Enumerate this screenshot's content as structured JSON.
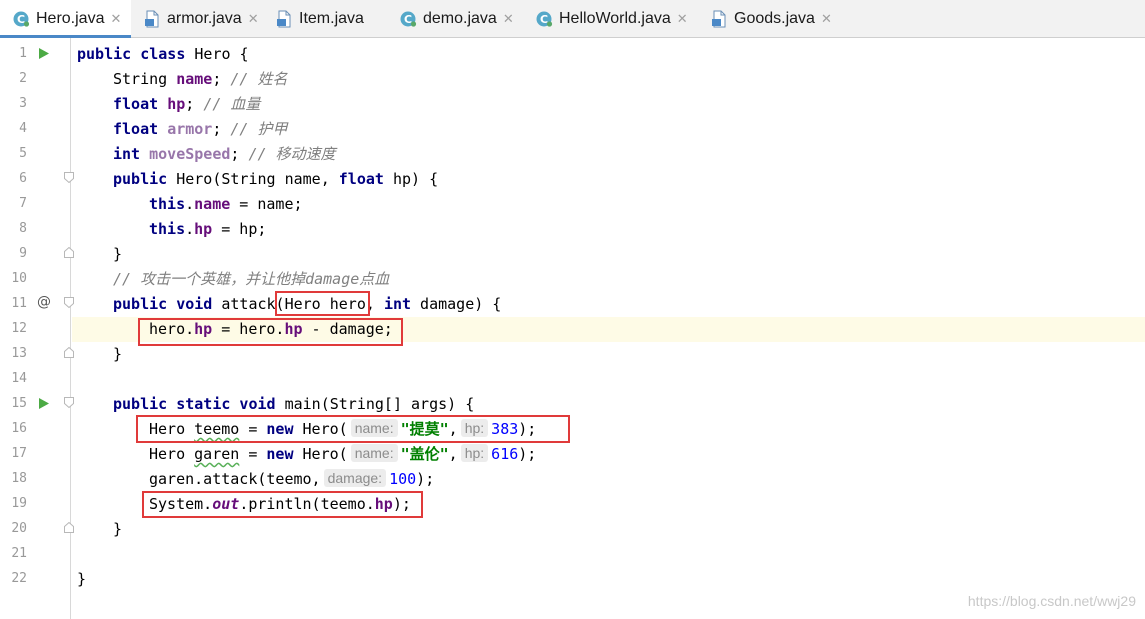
{
  "tabs": [
    {
      "label": "Hero.java",
      "icon": "java-class-icon",
      "active": true,
      "closable": true
    },
    {
      "label": "armor.java",
      "icon": "java-file-icon",
      "active": false,
      "closable": true
    },
    {
      "label": "Item.java",
      "icon": "java-file-icon",
      "active": false,
      "closable": false
    },
    {
      "label": "demo.java",
      "icon": "java-class-icon",
      "active": false,
      "closable": true
    },
    {
      "label": "HelloWorld.java",
      "icon": "java-class-icon",
      "active": false,
      "closable": true
    },
    {
      "label": "Goods.java",
      "icon": "java-file-icon",
      "active": false,
      "closable": true
    }
  ],
  "close_glyph": "✕",
  "line_numbers": [
    "1",
    "2",
    "3",
    "4",
    "5",
    "6",
    "7",
    "8",
    "9",
    "10",
    "11",
    "12",
    "13",
    "14",
    "15",
    "16",
    "17",
    "18",
    "19",
    "20",
    "21",
    "22"
  ],
  "gutter": {
    "override_marker": "@",
    "run_lines": [
      1,
      15
    ],
    "current_line": 12
  },
  "code": {
    "l1": {
      "kw1": "public class",
      "rest": " Hero {"
    },
    "l2": {
      "type": "String ",
      "name": "name",
      "semi": "; ",
      "comment": "// 姓名"
    },
    "l3": {
      "kw": "float ",
      "name": "hp",
      "semi": "; ",
      "comment": "// 血量"
    },
    "l4": {
      "kw": "float ",
      "name": "armor",
      "semi": "; ",
      "comment": "// 护甲"
    },
    "l5": {
      "kw": "int ",
      "name": "moveSpeed",
      "semi": "; ",
      "comment": "// 移动速度"
    },
    "l6": {
      "kw": "public ",
      "a": "Hero(String name, ",
      "kw2": "float",
      "b": " hp) {"
    },
    "l7": {
      "kw": "this",
      "dot": ".",
      "fld": "name",
      "rest": " = name;"
    },
    "l8": {
      "kw": "this",
      "dot": ".",
      "fld": "hp",
      "rest": " = hp;"
    },
    "l9": {
      "text": "}"
    },
    "l10": {
      "comment": "// 攻击一个英雄，并让他掉damage点血"
    },
    "l11": {
      "kw": "public void ",
      "a": "attack(Hero hero, ",
      "kw2": "int",
      "b": " damage) {"
    },
    "l12": {
      "a": "hero.",
      "f1": "hp",
      "b": " = hero.",
      "f2": "hp",
      "c": " - damage;"
    },
    "l13": {
      "text": "}"
    },
    "l15": {
      "kw": "public static void ",
      "rest": "main(String[] args) {"
    },
    "l16": {
      "a": "Hero ",
      "var": "teemo",
      "b": " = ",
      "kw": "new",
      "c": " Hero(",
      "hint1": "name:",
      "str": "\"提莫\"",
      "d": ",",
      "hint2": "hp:",
      "num": "383",
      "e": ");"
    },
    "l17": {
      "a": "Hero ",
      "var": "garen",
      "b": " = ",
      "kw": "new",
      "c": " Hero(",
      "hint1": "name:",
      "str": "\"盖伦\"",
      "d": ",",
      "hint2": "hp:",
      "num": "616",
      "e": ");"
    },
    "l18": {
      "a": "garen.attack(teemo,",
      "hint": "damage:",
      "num": "100",
      "e": ");"
    },
    "l19": {
      "a": "System.",
      "stat": "out",
      "b": ".println(teemo.",
      "fld": "hp",
      "c": ");"
    },
    "l20": {
      "text": "}"
    },
    "l22": {
      "text": "}"
    }
  },
  "watermark": "https://blog.csdn.net/wwj29"
}
